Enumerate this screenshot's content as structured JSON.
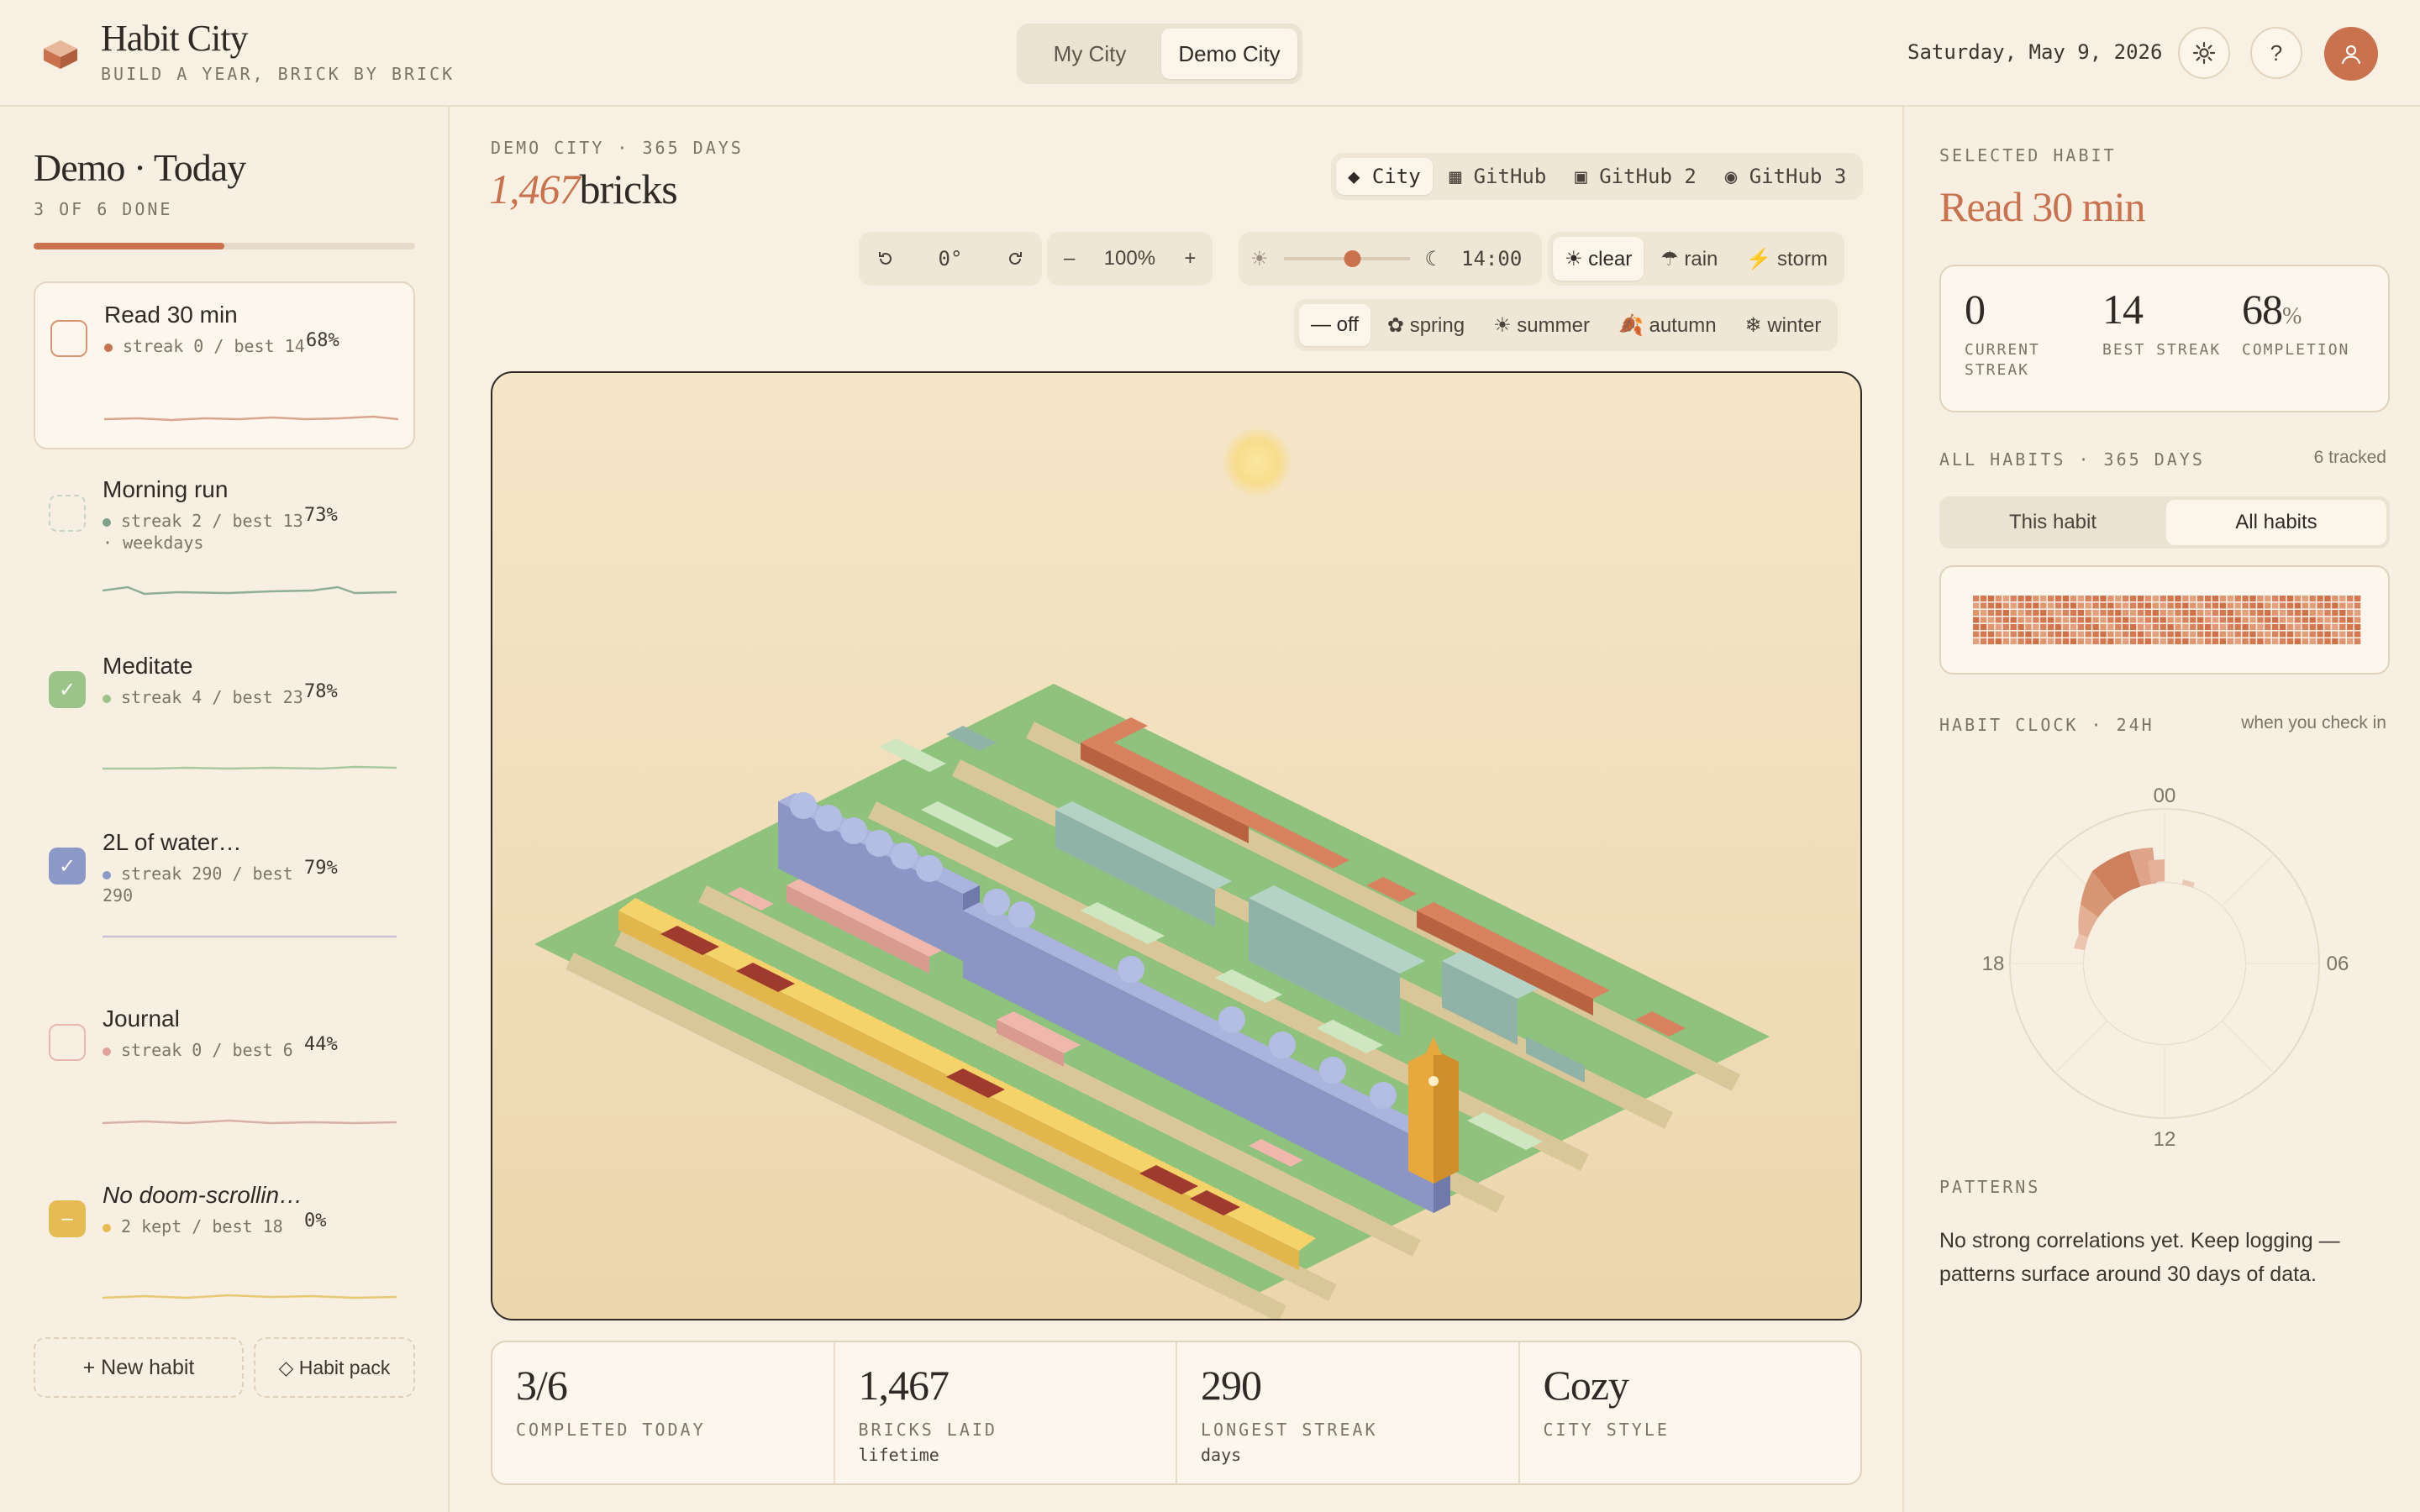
{
  "header": {
    "app_title": "Habit City",
    "app_subtitle": "BUILD A YEAR, BRICK BY BRICK",
    "tabs": [
      {
        "label": "My City",
        "active": false
      },
      {
        "label": "Demo City",
        "active": true
      }
    ],
    "date": "Saturday, May 9, 2026",
    "settings_icon": "gear-icon",
    "help_label": "?",
    "avatar_icon": "user-icon"
  },
  "left": {
    "title": "Demo · Today",
    "subtitle": "3 OF 6 DONE",
    "progress": 0.5,
    "habits": [
      {
        "name": "Read 30 min",
        "meta": "streak 0 / best 14",
        "pct": "68%",
        "color": "#c9724d",
        "checked": false,
        "selected": true
      },
      {
        "name": "Morning run",
        "meta": "streak 2 / best 13 · weekdays",
        "pct": "73%",
        "color": "#7fa08a",
        "checked": false,
        "selected": false
      },
      {
        "name": "Meditate",
        "meta": "streak 4 / best 23",
        "pct": "78%",
        "color": "#9cc48a",
        "checked": true,
        "selected": false
      },
      {
        "name": "2L of water…",
        "meta": "streak 290 / best 290",
        "pct": "79%",
        "color": "#8c98c8",
        "checked": true,
        "selected": false
      },
      {
        "name": "Journal",
        "meta": "streak 0 / best 6",
        "pct": "44%",
        "color": "#e0a39a",
        "checked": false,
        "selected": false
      },
      {
        "name": "No doom-scrollin…",
        "meta": "2 kept / best 18",
        "pct": "0%",
        "color": "#e5bc52",
        "checked": false,
        "selected": false
      }
    ],
    "new_habit_label": "+ New habit",
    "habit_pack_label": "◇ Habit pack"
  },
  "main": {
    "kicker": "DEMO CITY · 365 DAYS",
    "bricks_number": "1,467",
    "bricks_label": "bricks",
    "source_tabs": [
      {
        "label": "◆ City",
        "active": true
      },
      {
        "label": "▦ GitHub",
        "active": false
      },
      {
        "label": "▣ GitHub 2",
        "active": false
      },
      {
        "label": "◉ GitHub 3",
        "active": false
      }
    ],
    "rotate_left_icon": "rotate-left-icon",
    "rotation": "0°",
    "rotate_right_icon": "rotate-right-icon",
    "zoom_out": "–",
    "zoom": "100%",
    "zoom_in": "+",
    "time_sun_icon": "☀",
    "time_moon_icon": "☾",
    "time_value": 0.55,
    "time": "14:00",
    "weather": [
      {
        "label": "☀ clear",
        "active": true
      },
      {
        "label": "☂ rain",
        "active": false
      },
      {
        "label": "⚡ storm",
        "active": false
      }
    ],
    "seasons": [
      {
        "label": "— off",
        "active": true
      },
      {
        "label": "✿ spring",
        "active": false
      },
      {
        "label": "☀ summer",
        "active": false
      },
      {
        "label": "🍂 autumn",
        "active": false
      },
      {
        "label": "❄ winter",
        "active": false
      }
    ],
    "stats": [
      {
        "value": "3/6",
        "label": "COMPLETED TODAY",
        "sub": ""
      },
      {
        "value": "1,467",
        "label": "BRICKS LAID",
        "sub": "lifetime"
      },
      {
        "value": "290",
        "label": "LONGEST STREAK",
        "sub": "days"
      },
      {
        "value": "Cozy",
        "label": "CITY STYLE",
        "sub": ""
      }
    ]
  },
  "right": {
    "kicker": "SELECTED HABIT",
    "habit_name": "Read 30 min",
    "current_streak": "0",
    "current_streak_label": "CURRENT STREAK",
    "best_streak": "14",
    "best_streak_label": "BEST STREAK",
    "completion": "68",
    "completion_unit": "%",
    "completion_label": "COMPLETION",
    "all_habits_kicker": "ALL HABITS · 365 DAYS",
    "tracked": "6 tracked",
    "toggle": [
      {
        "label": "This habit",
        "active": false
      },
      {
        "label": "All habits",
        "active": true
      }
    ],
    "clock_kicker": "HABIT CLOCK · 24H",
    "clock_note": "when you check in",
    "clock_labels": {
      "top": "00",
      "right": "06",
      "bottom": "12",
      "left": "18"
    },
    "patterns_kicker": "PATTERNS",
    "patterns_text": "No strong correlations yet. Keep logging — patterns surface around 30 days of data."
  }
}
